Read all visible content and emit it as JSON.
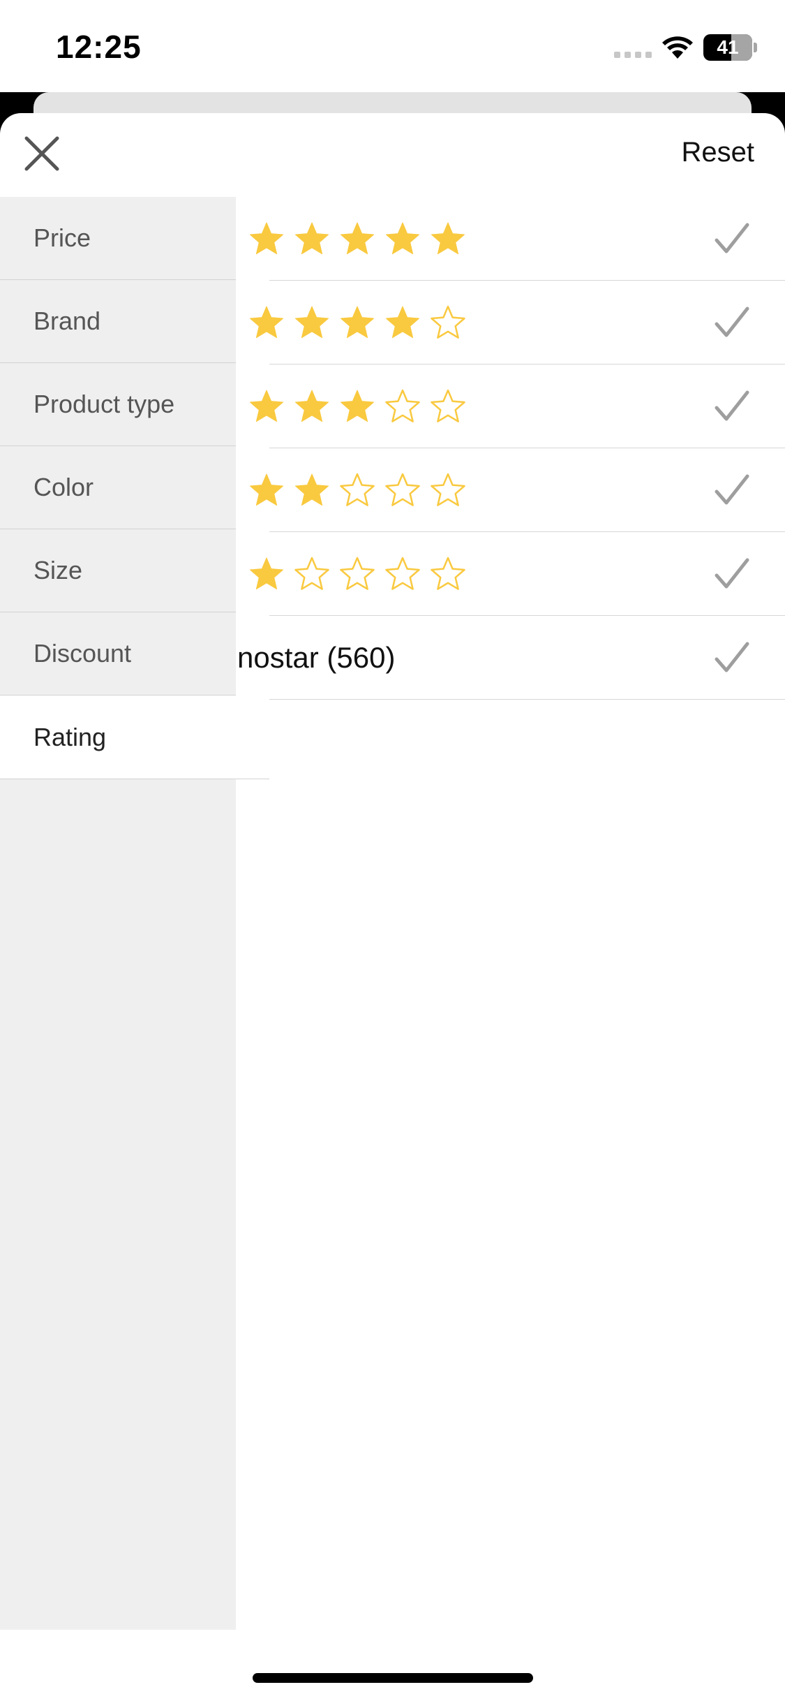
{
  "status_bar": {
    "time": "12:25",
    "battery_percent": "41"
  },
  "header": {
    "close_icon": "close-icon",
    "reset_label": "Reset"
  },
  "categories": [
    {
      "label": "Price",
      "active": false
    },
    {
      "label": "Brand",
      "active": false
    },
    {
      "label": "Product type",
      "active": false
    },
    {
      "label": "Color",
      "active": false
    },
    {
      "label": "Size",
      "active": false
    },
    {
      "label": "Discount",
      "active": false
    },
    {
      "label": "Rating",
      "active": true
    }
  ],
  "rating_options": [
    {
      "stars_filled": 5,
      "stars_total": 5,
      "checked": false
    },
    {
      "stars_filled": 4,
      "stars_total": 5,
      "checked": false
    },
    {
      "stars_filled": 3,
      "stars_total": 5,
      "checked": false
    },
    {
      "stars_filled": 2,
      "stars_total": 5,
      "checked": false
    },
    {
      "stars_filled": 1,
      "stars_total": 5,
      "checked": false
    },
    {
      "label": "nostar (560)",
      "checked": false
    }
  ],
  "colors": {
    "star": "#f9c93f",
    "check": "#9e9e9e",
    "sidebar_bg": "#efefef"
  }
}
